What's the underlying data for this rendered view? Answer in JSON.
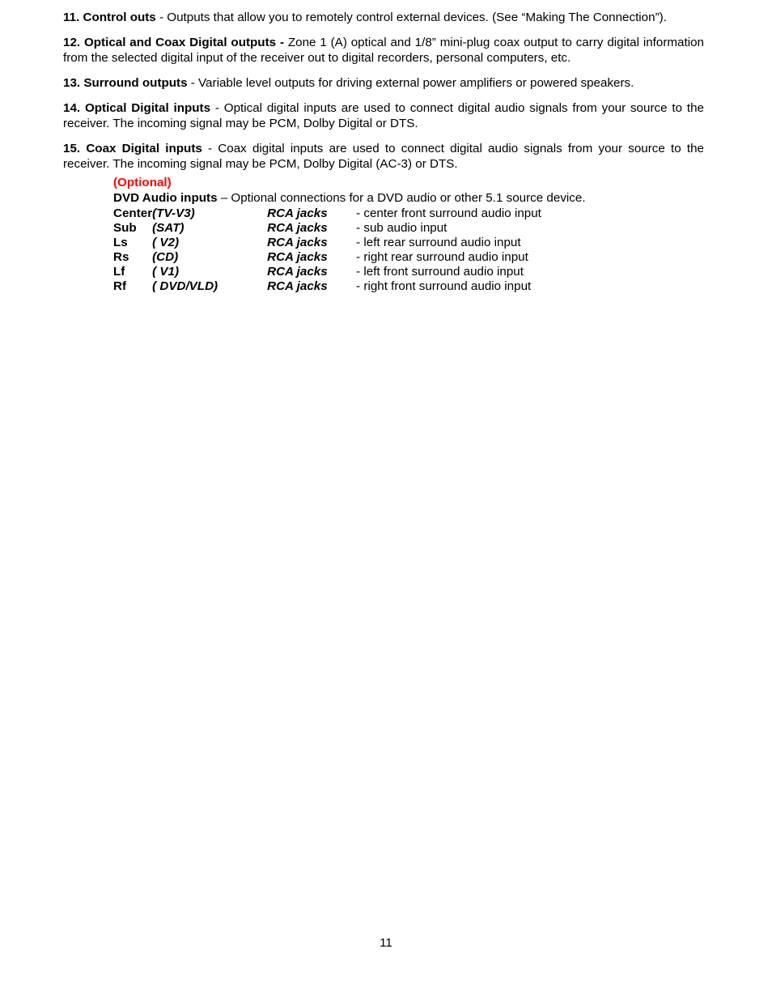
{
  "document": {
    "page_number": "11",
    "optional_color": "#ff0000"
  },
  "paragraphs": [
    {
      "lead": "11. Control outs",
      "body": " - Outputs that allow you to remotely control external devices. (See “Making The Connection”)."
    },
    {
      "lead": "12. Optical and Coax Digital outputs -",
      "body": " Zone 1 (A) optical and 1/8” mini-plug coax output to carry digital information from the selected digital input of the receiver out to digital recorders, personal computers, etc."
    },
    {
      "lead": "13. Surround outputs",
      "body": " - Variable level outputs for driving external power amplifiers or powered speakers."
    },
    {
      "lead": "14. Optical Digital inputs",
      "body": " - Optical digital inputs are used to connect digital audio signals from your source to the receiver. The incoming signal may be PCM, Dolby Digital or DTS."
    },
    {
      "lead": "15. Coax Digital inputs",
      "body": " - Coax digital inputs are used to connect digital audio signals from your source to the receiver. The incoming signal may be PCM, Dolby Digital (AC-3) or DTS."
    }
  ],
  "optional_section": {
    "label": "(Optional)",
    "title": "DVD Audio inputs",
    "title_rest": " – Optional connections for a DVD audio or other 5.1 source device.",
    "rows": [
      {
        "name": "Center",
        "code": "(TV-V3)",
        "jack": "RCA jacks",
        "desc": "- center front surround audio input"
      },
      {
        "name": "Sub",
        "code": "(SAT)",
        "jack": "RCA jacks",
        "desc": "- sub audio input"
      },
      {
        "name": "Ls",
        "code": "( V2)",
        "jack": "RCA jacks",
        "desc": "- left rear surround audio input"
      },
      {
        "name": "Rs",
        "code": "(CD)",
        "jack": "RCA jacks",
        "desc": "- right rear surround audio input"
      },
      {
        "name": "Lf",
        "code": "( V1)",
        "jack": "RCA jacks",
        "desc": "- left front surround audio input"
      },
      {
        "name": "Rf",
        "code": "( DVD/VLD)",
        "jack": "RCA jacks",
        "desc": "- right front surround audio input"
      }
    ]
  }
}
